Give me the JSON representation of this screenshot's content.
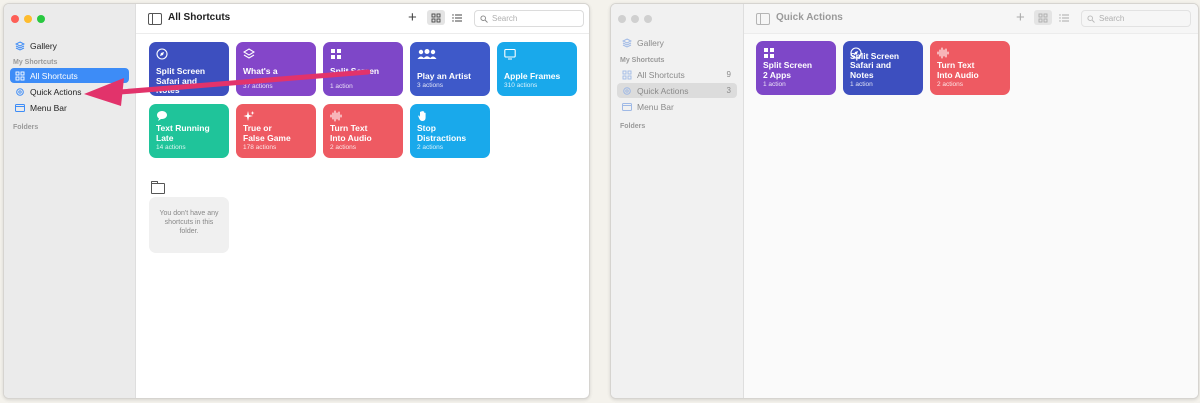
{
  "colors": {
    "accent_blue": "#3d8cf7",
    "arrow_pink": "#e2336b",
    "tile_purple": "#8446c9",
    "tile_indigo": "#3d4fbf",
    "tile_blue": "#3e66cf",
    "tile_cyan": "#19a9eb",
    "tile_teal": "#1fc49a",
    "tile_red": "#ee5a62"
  },
  "left_window": {
    "title": "All Shortcuts",
    "search_placeholder": "Search",
    "sidebar": {
      "gallery": "Gallery",
      "my_shortcuts_header": "My Shortcuts",
      "items": [
        {
          "label": "All Shortcuts",
          "icon": "grid-icon",
          "selected": true
        },
        {
          "label": "Quick Actions",
          "icon": "gear-icon",
          "selected": false
        },
        {
          "label": "Menu Bar",
          "icon": "menubar-icon",
          "selected": false
        }
      ],
      "folders_header": "Folders"
    },
    "tiles": [
      {
        "title": "Split Screen\nSafari and Notes",
        "subtitle": "",
        "color": "#3d4fbf",
        "icon": "compass-icon"
      },
      {
        "title": "What's a\n",
        "subtitle": "37 actions",
        "color": "#8446c9",
        "icon": "layers-icon"
      },
      {
        "title": "Split Screen\n",
        "subtitle": "1 action",
        "color": "#7e47c8",
        "icon": "grid-icon"
      },
      {
        "title": "Play an Artist",
        "subtitle": "3 actions",
        "color": "#3e59c9",
        "icon": "people-icon"
      },
      {
        "title": "Apple Frames",
        "subtitle": "310 actions",
        "color": "#19a9eb",
        "icon": "display-icon"
      },
      {
        "title": "Text Running Late",
        "subtitle": "14 actions",
        "color": "#1fc49a",
        "icon": "speech-bubble-icon"
      },
      {
        "title": "True or\nFalse Game",
        "subtitle": "178 actions",
        "color": "#ee5a62",
        "icon": "sparkle-icon"
      },
      {
        "title": "Turn Text\nInto Audio",
        "subtitle": "2 actions",
        "color": "#ee5a62",
        "icon": "waveform-icon"
      },
      {
        "title": "Stop Distractions",
        "subtitle": "2 actions",
        "color": "#19a9eb",
        "icon": "hand-icon"
      }
    ],
    "empty_folder_text": "You don't have any shortcuts in this folder."
  },
  "right_window": {
    "title": "Quick Actions",
    "search_placeholder": "Search",
    "sidebar": {
      "gallery": "Gallery",
      "my_shortcuts_header": "My Shortcuts",
      "items": [
        {
          "label": "All Shortcuts",
          "count": "9",
          "icon": "grid-icon"
        },
        {
          "label": "Quick Actions",
          "count": "3",
          "icon": "gear-icon",
          "selected": true
        },
        {
          "label": "Menu Bar",
          "count": "",
          "icon": "menubar-icon"
        }
      ],
      "folders_header": "Folders"
    },
    "tiles": [
      {
        "title": "Split Screen\n2 Apps",
        "subtitle": "1 action",
        "color": "#7e47c8",
        "icon": "grid-icon"
      },
      {
        "title": "Split Screen\nSafari and Notes",
        "subtitle": "1 action",
        "color": "#3d4fbf",
        "icon": "compass-icon"
      },
      {
        "title": "Turn Text\nInto Audio",
        "subtitle": "2 actions",
        "color": "#ee5a62",
        "icon": "waveform-icon"
      }
    ]
  }
}
